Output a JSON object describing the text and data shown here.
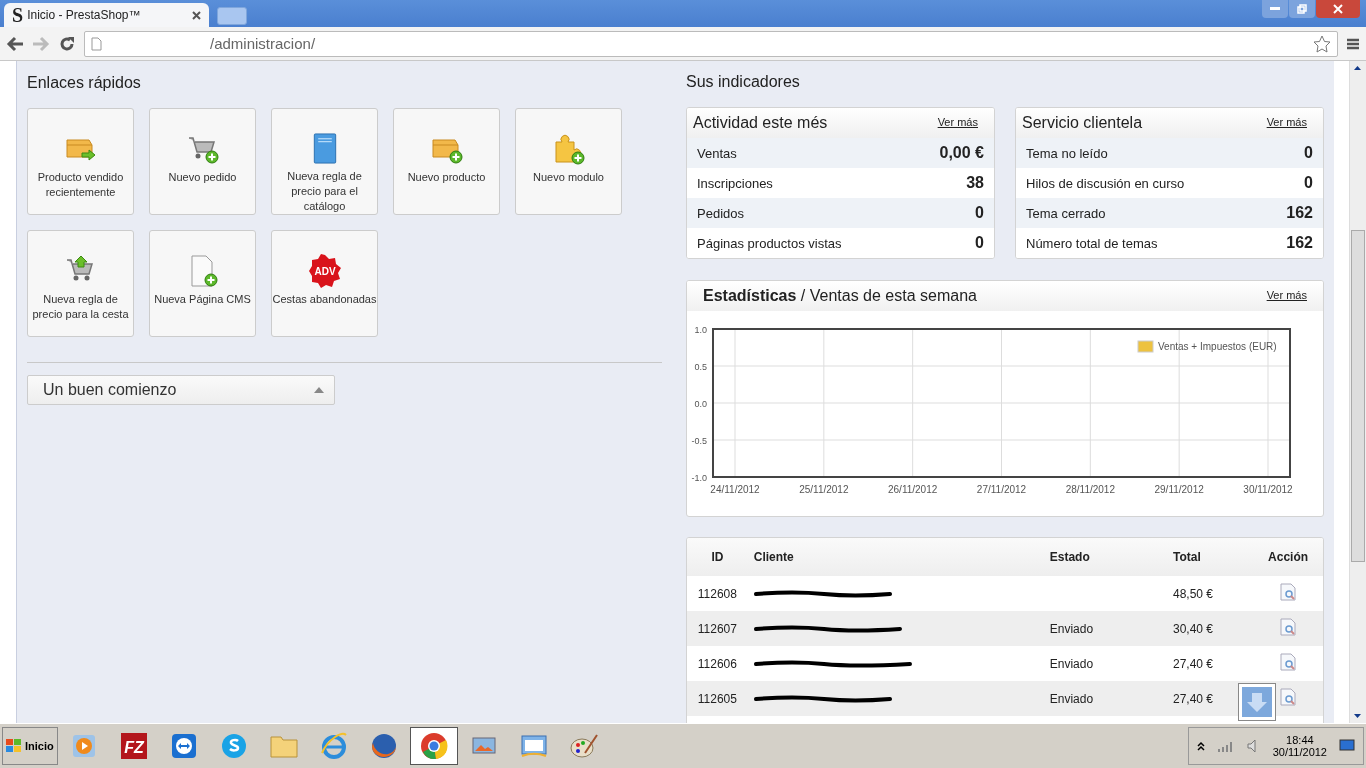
{
  "browser": {
    "tab_title": "Inicio - PrestaShop™",
    "tab_logo": "S",
    "address": "/administracion/"
  },
  "quick_links": {
    "title": "Enlaces rápidos",
    "items": [
      {
        "kind": "box-arrow",
        "label": "Producto vendido recientemente"
      },
      {
        "kind": "cart-plus",
        "label": "Nuevo pedido"
      },
      {
        "kind": "book",
        "label": "Nueva regla de precio para el catálogo"
      },
      {
        "kind": "box-plus",
        "label": "Nuevo producto"
      },
      {
        "kind": "puzzle-plus",
        "label": "Nuevo modulo"
      },
      {
        "kind": "cart-up",
        "label": "Nueva regla de precio para la cesta"
      },
      {
        "kind": "page-plus",
        "label": "Nueva Página CMS"
      },
      {
        "kind": "badge",
        "badge_text": "ADV",
        "label": "Cestas abandonadas"
      }
    ]
  },
  "good_start": {
    "title": "Un buen comienzo",
    "expanded": false
  },
  "indicators": {
    "title": "Sus indicadores",
    "cards": [
      {
        "title": "Actividad este més",
        "link": "Ver más",
        "rows": [
          {
            "label": "Ventas",
            "value": "0,00 €"
          },
          {
            "label": "Inscripciones",
            "value": "38"
          },
          {
            "label": "Pedidos",
            "value": "0"
          },
          {
            "label": "Páginas productos vistas",
            "value": "0"
          }
        ]
      },
      {
        "title": "Servicio clientela",
        "link": "Ver más",
        "rows": [
          {
            "label": "Tema no leído",
            "value": "0"
          },
          {
            "label": "Hilos de discusión en curso",
            "value": "0"
          },
          {
            "label": "Tema cerrado",
            "value": "162"
          },
          {
            "label": "Número total de temas",
            "value": "162"
          }
        ]
      }
    ]
  },
  "stats": {
    "title_bold": "Estadísticas",
    "title_rest": "/ Ventas de esta semana",
    "link": "Ver más",
    "chart_data": {
      "type": "line",
      "grid": true,
      "categories": [
        "24/11/2012",
        "25/11/2012",
        "26/11/2012",
        "27/11/2012",
        "28/11/2012",
        "29/11/2012",
        "30/11/2012"
      ],
      "series": [
        {
          "name": "Ventas + Impuestos (EUR)",
          "color": "#edc240",
          "values": [
            null,
            null,
            null,
            null,
            null,
            null,
            null
          ]
        }
      ],
      "ylim": [
        -1,
        1
      ],
      "yticks": [
        {
          "value": 1,
          "label": "1.0"
        },
        {
          "value": 0.5,
          "label": "0.5"
        },
        {
          "value": 0,
          "label": "0.0"
        },
        {
          "value": -0.5,
          "label": "-0.5"
        },
        {
          "value": -1,
          "label": "-1.0"
        }
      ]
    }
  },
  "orders": {
    "columns": [
      "ID",
      "Cliente",
      "Estado",
      "Total",
      "Acción"
    ],
    "rows": [
      {
        "id": "112608",
        "client_redacted": true,
        "total": "48,50 €"
      },
      {
        "id": "112607",
        "client_redacted": true,
        "status": "Enviado",
        "total": "30,40 €"
      },
      {
        "id": "112606",
        "client_redacted": true,
        "status": "Enviado",
        "total": "27,40 €"
      },
      {
        "id": "112605",
        "client_redacted": true,
        "status": "Enviado",
        "total": "27,40 €"
      }
    ]
  },
  "taskbar": {
    "start": "Inicio",
    "apps": [
      {
        "kind": "media",
        "active": false
      },
      {
        "kind": "filezilla",
        "label": "FZ",
        "active": false
      },
      {
        "kind": "teamviewer",
        "active": false
      },
      {
        "kind": "skype",
        "active": false
      },
      {
        "kind": "folder",
        "active": false
      },
      {
        "kind": "ie",
        "active": false
      },
      {
        "kind": "firefox",
        "active": false
      },
      {
        "kind": "chrome",
        "active": true
      },
      {
        "kind": "photos",
        "active": false
      },
      {
        "kind": "mail",
        "active": false
      },
      {
        "kind": "paint",
        "active": false
      }
    ],
    "time": "18:44",
    "date": "30/11/2012"
  }
}
